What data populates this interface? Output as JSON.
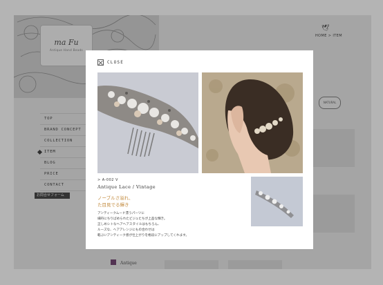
{
  "background": {
    "logo": {
      "mark": "ma Fu",
      "sub": "Antique Hand Beads"
    },
    "header": {
      "breadcrumb": "HOME > ITEM"
    },
    "nav": [
      {
        "label": "TOP"
      },
      {
        "label": "BRAND CONCEPT"
      },
      {
        "label": "COLLECTION"
      },
      {
        "label": "ITEM",
        "active": true
      },
      {
        "label": "BLOG"
      },
      {
        "label": "PRICE"
      },
      {
        "label": "CONTACT"
      }
    ],
    "form_button": "お問合せフォーム",
    "badge": "NATURAL",
    "footer_label": "Antique"
  },
  "modal": {
    "close_label": "CLOSE",
    "item_code": "> A-002 V",
    "item_title": "Antique Lace / Vintage",
    "catch_lines": [
      "ノーブルさ溢れ、",
      "た目見でる輝き"
    ],
    "description_lines": [
      "アンティークムード漂うパーツに",
      "細丹にちりばめられたビジュたちが上品な輝き。",
      "正しめシトなヘアヘアスタイルはもちろん、",
      "ルーズな、ヘアアレンジにもの合わせは",
      "軽ぶいアンティーク感が仕上がりを格段にアップしてくれます。"
    ]
  },
  "colors": {
    "accent": "#c28a3c",
    "overlay": "rgba(40,40,40,0.35)"
  }
}
